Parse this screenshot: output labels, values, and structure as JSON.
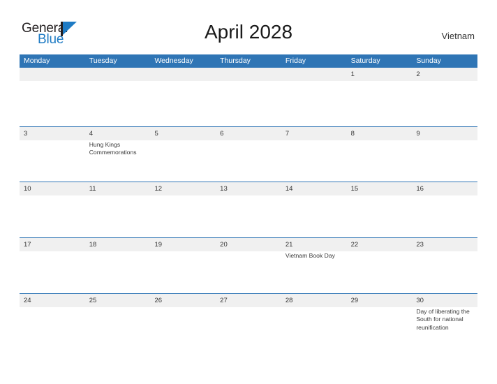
{
  "brand": {
    "word_one": "General",
    "word_two": "Blue",
    "flag_icon": "flag-triangle-icon",
    "accent_color": "#1e7bc4"
  },
  "header": {
    "title": "April 2028",
    "country": "Vietnam"
  },
  "calendar": {
    "header_color": "#2f75b5",
    "row_shade_color": "#f0f0f0",
    "weekdays": [
      "Monday",
      "Tuesday",
      "Wednesday",
      "Thursday",
      "Friday",
      "Saturday",
      "Sunday"
    ],
    "weeks": [
      {
        "days": [
          {
            "number": "",
            "event": ""
          },
          {
            "number": "",
            "event": ""
          },
          {
            "number": "",
            "event": ""
          },
          {
            "number": "",
            "event": ""
          },
          {
            "number": "",
            "event": ""
          },
          {
            "number": "1",
            "event": ""
          },
          {
            "number": "2",
            "event": ""
          }
        ]
      },
      {
        "days": [
          {
            "number": "3",
            "event": ""
          },
          {
            "number": "4",
            "event": "Hung Kings Commemorations"
          },
          {
            "number": "5",
            "event": ""
          },
          {
            "number": "6",
            "event": ""
          },
          {
            "number": "7",
            "event": ""
          },
          {
            "number": "8",
            "event": ""
          },
          {
            "number": "9",
            "event": ""
          }
        ]
      },
      {
        "days": [
          {
            "number": "10",
            "event": ""
          },
          {
            "number": "11",
            "event": ""
          },
          {
            "number": "12",
            "event": ""
          },
          {
            "number": "13",
            "event": ""
          },
          {
            "number": "14",
            "event": ""
          },
          {
            "number": "15",
            "event": ""
          },
          {
            "number": "16",
            "event": ""
          }
        ]
      },
      {
        "days": [
          {
            "number": "17",
            "event": ""
          },
          {
            "number": "18",
            "event": ""
          },
          {
            "number": "19",
            "event": ""
          },
          {
            "number": "20",
            "event": ""
          },
          {
            "number": "21",
            "event": "Vietnam Book Day"
          },
          {
            "number": "22",
            "event": ""
          },
          {
            "number": "23",
            "event": ""
          }
        ]
      },
      {
        "days": [
          {
            "number": "24",
            "event": ""
          },
          {
            "number": "25",
            "event": ""
          },
          {
            "number": "26",
            "event": ""
          },
          {
            "number": "27",
            "event": ""
          },
          {
            "number": "28",
            "event": ""
          },
          {
            "number": "29",
            "event": ""
          },
          {
            "number": "30",
            "event": "Day of liberating the South for national reunification"
          }
        ]
      }
    ]
  }
}
